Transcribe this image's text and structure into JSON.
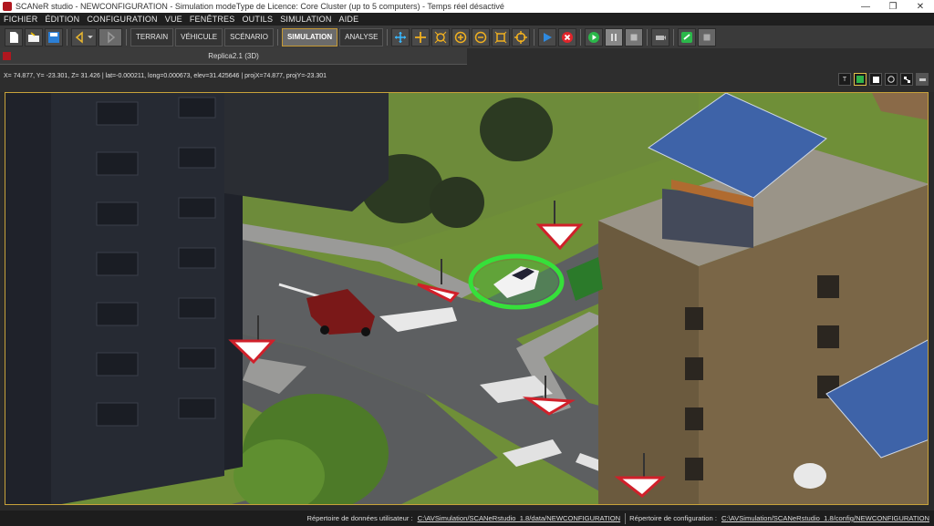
{
  "window": {
    "title": "SCANeR studio - NEWCONFIGURATION - Simulation modeType de Licence: Core Cluster (up to 5 computers) - Temps réel désactivé"
  },
  "menu": [
    "FICHIER",
    "ÉDITION",
    "CONFIGURATION",
    "VUE",
    "FENÊTRES",
    "OUTILS",
    "SIMULATION",
    "AIDE"
  ],
  "modes": {
    "terrain": "TERRAIN",
    "vehicle": "VÉHICULE",
    "scenario": "SCÉNARIO",
    "simulation": "SIMULATION",
    "analysis": "ANALYSE",
    "active": "SIMULATION"
  },
  "subwindow": {
    "title": "Replica2.1 (3D)",
    "coords": "X=  74.877, Y=  -23.301, Z=  31.426  | lat=-0.000211, long=0.000673, elev=31.425646 | projX=74.877, projY=-23.301"
  },
  "view_buttons": [
    "T"
  ],
  "status": {
    "user_dir_label": "Répertoire de données utilisateur :",
    "user_dir_path": "C:\\AVSimulation/SCANeRstudio_1.8/data/NEWCONFIGURATION",
    "config_dir_label": "Répertoire de configuration :",
    "config_dir_path": "C:\\AVSimulation/SCANeRstudio_1.8/config/NEWCONFIGURATION"
  },
  "colors": {
    "accent": "#c8a23a",
    "selection": "#36e03a",
    "grass": "#7a9a3c",
    "road": "#5b5d5f"
  }
}
